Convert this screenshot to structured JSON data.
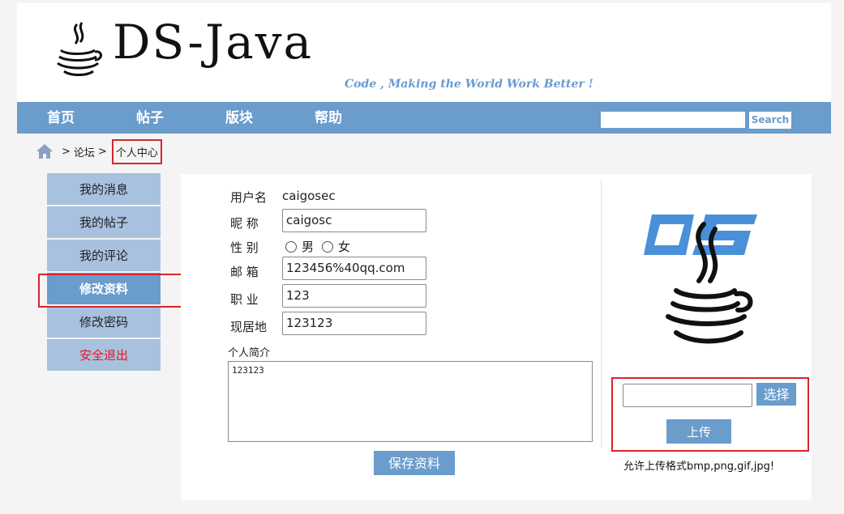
{
  "header": {
    "logo_text": "DS-Java",
    "slogan": "Code , Making the World Work Better !"
  },
  "nav": {
    "items": [
      {
        "label": "首页"
      },
      {
        "label": "帖子"
      },
      {
        "label": "版块"
      },
      {
        "label": "帮助"
      }
    ],
    "search": {
      "value": "",
      "button_label": "Search"
    }
  },
  "breadcrumb": {
    "items": [
      "论坛",
      "个人中心"
    ],
    "separator": ">"
  },
  "sidebar": {
    "items": [
      {
        "label": "我的消息"
      },
      {
        "label": "我的帖子"
      },
      {
        "label": "我的评论"
      },
      {
        "label": "修改资料"
      },
      {
        "label": "修改密码"
      },
      {
        "label": "安全退出"
      }
    ],
    "active_index": 3
  },
  "form": {
    "username_label": "用户名",
    "username_value": "caigosec",
    "nickname_label": "昵  称",
    "nickname_value": "caigosc",
    "gender_label": "性  别",
    "gender_options": [
      "男",
      "女"
    ],
    "email_label": "邮  箱",
    "email_value": "123456%40qq.com",
    "job_label": "职  业",
    "job_value": "123",
    "residence_label": "现居地",
    "residence_value": "123123",
    "bio_label": "个人简介",
    "bio_value": "123123",
    "save_label": "保存资料"
  },
  "upload": {
    "choose_label": "选择",
    "upload_label": "上传",
    "hint": "允许上传格式bmp,png,gif,jpg!"
  },
  "colors": {
    "accent": "#6a9ccc",
    "sidebar_bg": "#a7c1df",
    "highlight": "#d9242c",
    "logout": "#e8161c"
  }
}
